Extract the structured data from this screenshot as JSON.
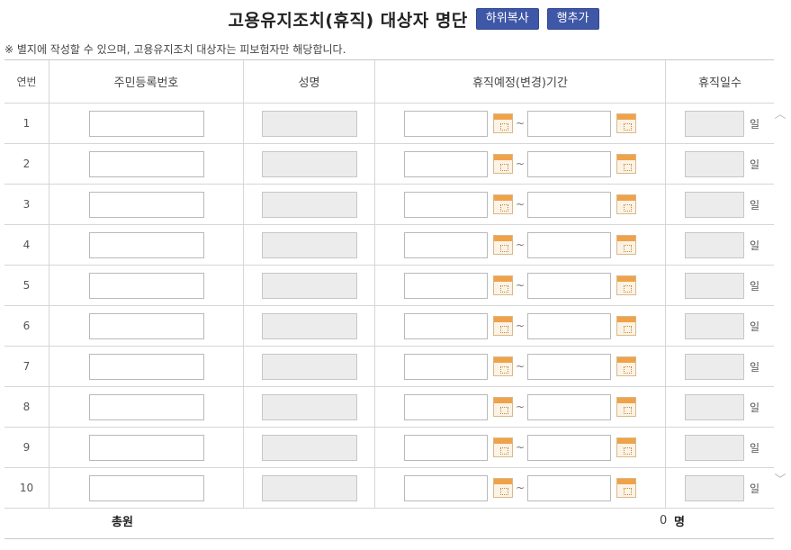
{
  "header": {
    "title": "고용유지조치(휴직) 대상자 명단",
    "copy_button": "하위복사",
    "add_row_button": "행추가"
  },
  "notice": "※ 별지에 작성할 수 있으며, 고용유지조치 대상자는 피보험자만 해당합니다.",
  "columns": {
    "no": "연번",
    "ssn": "주민등록번호",
    "name": "성명",
    "period": "휴직예정(변경)기간",
    "days": "휴직일수"
  },
  "rows": [
    {
      "no": "1"
    },
    {
      "no": "2"
    },
    {
      "no": "3"
    },
    {
      "no": "4"
    },
    {
      "no": "5"
    },
    {
      "no": "6"
    },
    {
      "no": "7"
    },
    {
      "no": "8"
    },
    {
      "no": "9"
    },
    {
      "no": "10"
    }
  ],
  "separator": "~",
  "day_unit": "일",
  "total": {
    "label": "총원",
    "value": "0",
    "unit": "명"
  },
  "icons": {
    "calendar": "calendar-icon",
    "scroll_up": "chevron-up-icon",
    "scroll_down": "chevron-down-icon"
  }
}
